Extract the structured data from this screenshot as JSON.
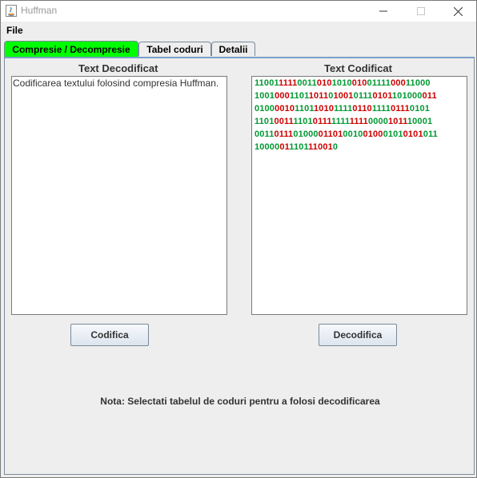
{
  "window": {
    "title": "Huffman"
  },
  "menu": {
    "file": "File"
  },
  "tabs": [
    {
      "label": "Compresie / Decompresie",
      "active": true,
      "color": "#00ff00"
    },
    {
      "label": "Tabel coduri",
      "active": false
    },
    {
      "label": "Detalii",
      "active": false
    }
  ],
  "left": {
    "heading": "Text Decodificat",
    "text": "Codificarea textului folosind compresia Huffman.",
    "button": "Codifica"
  },
  "right": {
    "heading": "Text Codificat",
    "button": "Decodifica",
    "colors": {
      "even": "#009933",
      "odd": "#cc0000"
    },
    "lines": [
      [
        "11001",
        "1111",
        "0011",
        "010",
        "1010",
        "010",
        "01111",
        "000",
        "11000"
      ],
      [
        "1001",
        "000",
        "1101",
        "1011",
        "0",
        "1001",
        "0111",
        "0101",
        "101000",
        "011"
      ],
      [
        "0100",
        "0010",
        "1101",
        "1010",
        "1111",
        "0110",
        "1111",
        "0111",
        "0101"
      ],
      [
        "1101",
        "0011",
        "1101",
        "0111",
        "1111",
        "1111",
        "0000",
        "1011",
        "10001"
      ],
      [
        "0011",
        "0111",
        "01000",
        "01101",
        "0010",
        "0100",
        "0101",
        "0101",
        "011"
      ],
      [
        "10000",
        "01",
        "1101",
        "11001",
        "0"
      ]
    ]
  },
  "note": "Nota: Selectati tabelul de coduri pentru a folosi decodificarea"
}
